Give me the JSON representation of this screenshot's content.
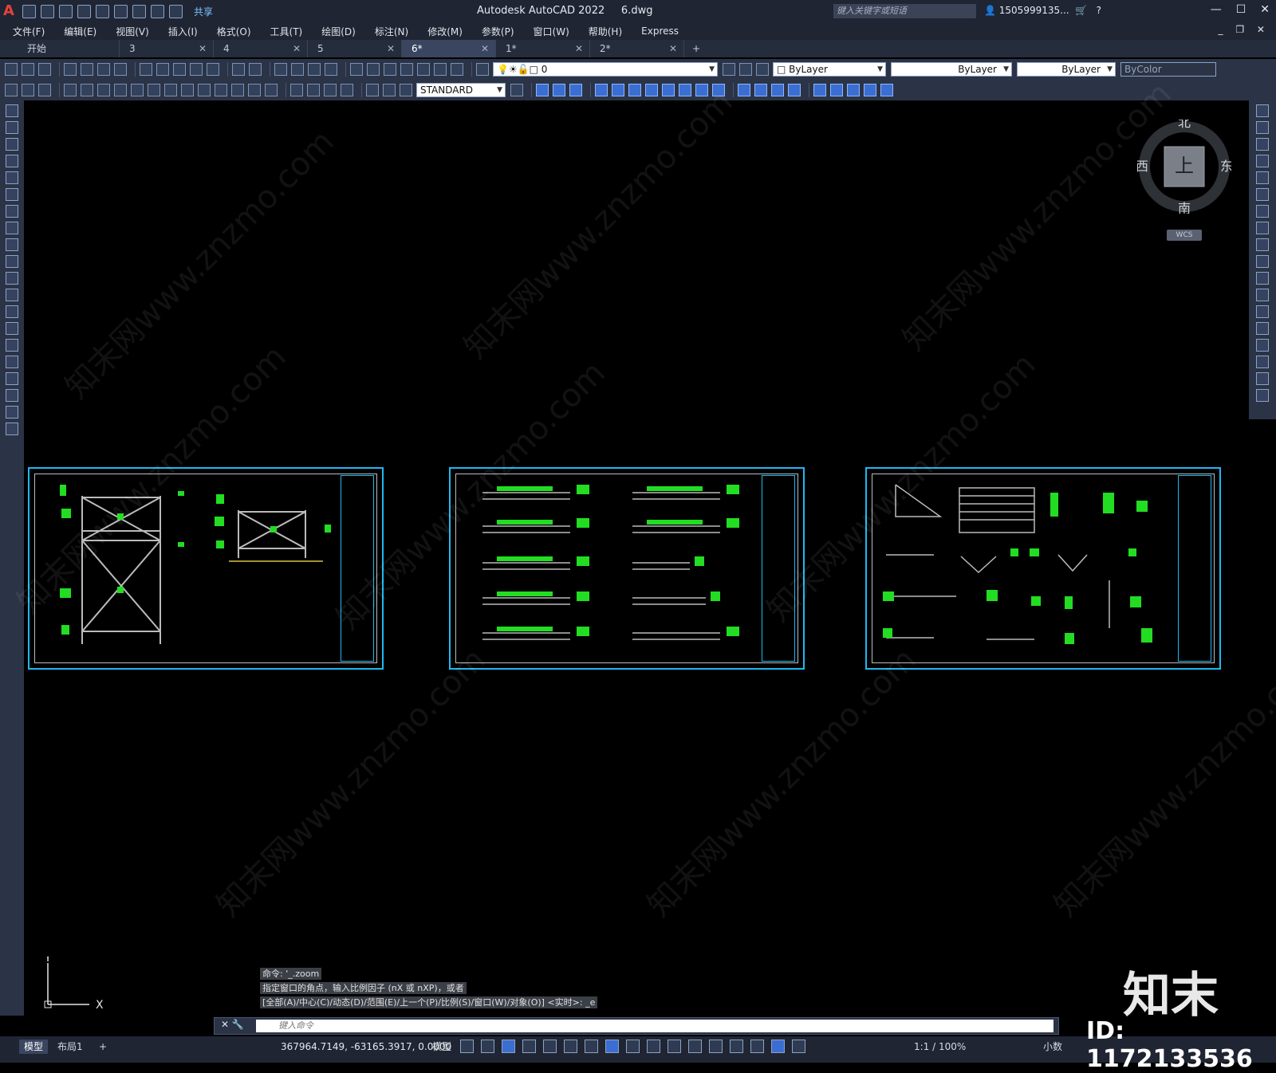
{
  "app": {
    "title": "Autodesk AutoCAD 2022",
    "filename": "6.dwg",
    "logo": "A",
    "share_label": "共享",
    "search_placeholder": "键入关键字或短语",
    "user": "1505999135...",
    "brand_color": "#e8413a",
    "accent_color": "#1fb8f0"
  },
  "menu": [
    "文件(F)",
    "编辑(E)",
    "视图(V)",
    "插入(I)",
    "格式(O)",
    "工具(T)",
    "绘图(D)",
    "标注(N)",
    "修改(M)",
    "参数(P)",
    "窗口(W)",
    "帮助(H)",
    "Express"
  ],
  "tabs": [
    {
      "label": "开始",
      "closable": false,
      "active": false
    },
    {
      "label": "3",
      "closable": true,
      "active": false
    },
    {
      "label": "4",
      "closable": true,
      "active": false
    },
    {
      "label": "5",
      "closable": true,
      "active": false
    },
    {
      "label": "6*",
      "closable": true,
      "active": true
    },
    {
      "label": "1*",
      "closable": true,
      "active": false
    },
    {
      "label": "2*",
      "closable": true,
      "active": false
    }
  ],
  "properties": {
    "layer": "0",
    "color": "ByLayer",
    "linetype": "ByLayer",
    "lineweight": "ByLayer",
    "plotstyle": "ByColor",
    "textstyle": "STANDARD"
  },
  "viewcube": {
    "north": "北",
    "south": "南",
    "east": "东",
    "west": "西",
    "face": "上",
    "wcs": "WCS"
  },
  "ucs": {
    "x": "X",
    "y": "Y"
  },
  "command": {
    "history": [
      "命令: '_.zoom",
      "指定窗口的角点，输入比例因子 (nX 或 nXP)，或者",
      "[全部(A)/中心(C)/动态(D)/范围(E)/上一个(P)/比例(S)/窗口(W)/对象(O)] <实时>: _e"
    ],
    "placeholder": "键入命令"
  },
  "layout_tabs": [
    "模型",
    "布局1"
  ],
  "add_layout": "+",
  "status": {
    "coords": "367964.7149, -63165.3917, 0.0000",
    "space": "模型",
    "scale": "1:1 / 100%",
    "units": "小数"
  },
  "watermark": {
    "text": "知末网www.znzmo.com",
    "brand": "知末",
    "id": "ID: 1172133536"
  }
}
